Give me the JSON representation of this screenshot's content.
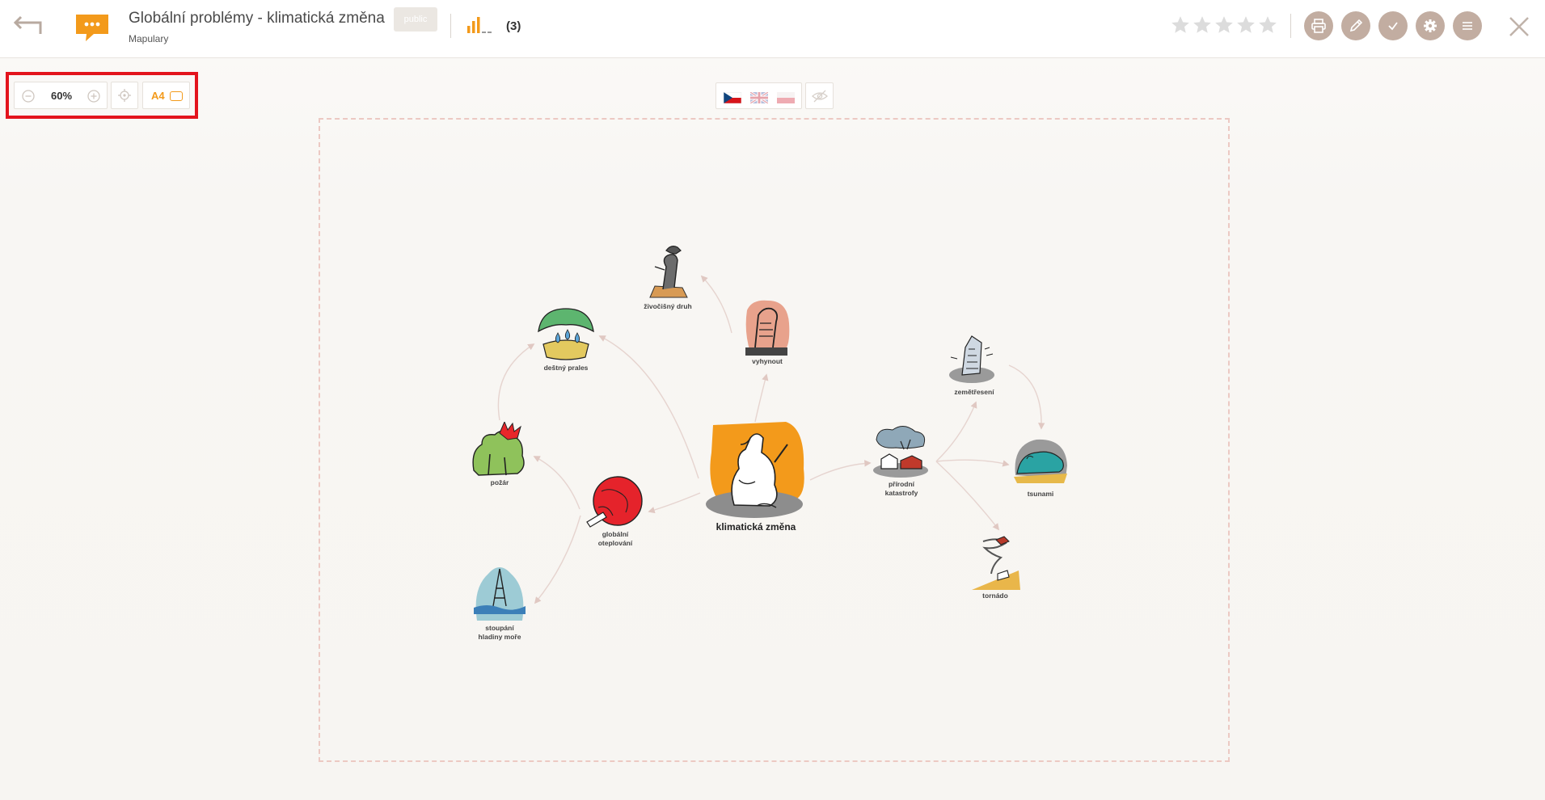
{
  "header": {
    "title": "Globální problémy - klimatická změna",
    "subtitle": "Mapulary",
    "visibility_badge": "public",
    "stats_count": "(3)",
    "rating_stars": 5,
    "icons": {
      "back": "back-arrow-icon",
      "logo": "chat-bubble-logo",
      "stats": "bar-chart-icon",
      "print": "printer-icon",
      "edit": "pencil-icon",
      "check": "check-icon",
      "settings": "gear-icon",
      "menu": "hamburger-icon",
      "close": "close-icon"
    }
  },
  "toolbar": {
    "zoom_level": "60%",
    "paper_format": "A4"
  },
  "languages": [
    "cs",
    "en",
    "pl"
  ],
  "colors": {
    "accent": "#f39a1b",
    "circle_buttons": "#c2ada1",
    "highlight": "#e3141d",
    "frame_dash": "#ecc9c3",
    "arrow": "#e0c8c2"
  },
  "mindmap": {
    "central": "klimatická změna",
    "nodes": {
      "zivocisny_druh": "živočišný druh",
      "vyhynout": "vyhynout",
      "destny_prales": "deštný prales",
      "pozar": "požár",
      "globalni_line1": "globální",
      "globalni_line2": "oteplování",
      "stoupani_line1": "stoupání",
      "stoupani_line2": "hladiny moře",
      "prirodni_line1": "přírodní",
      "prirodni_line2": "katastrofy",
      "zemetreseni": "zemětřesení",
      "tsunami": "tsunami",
      "tornado": "tornádo"
    }
  }
}
